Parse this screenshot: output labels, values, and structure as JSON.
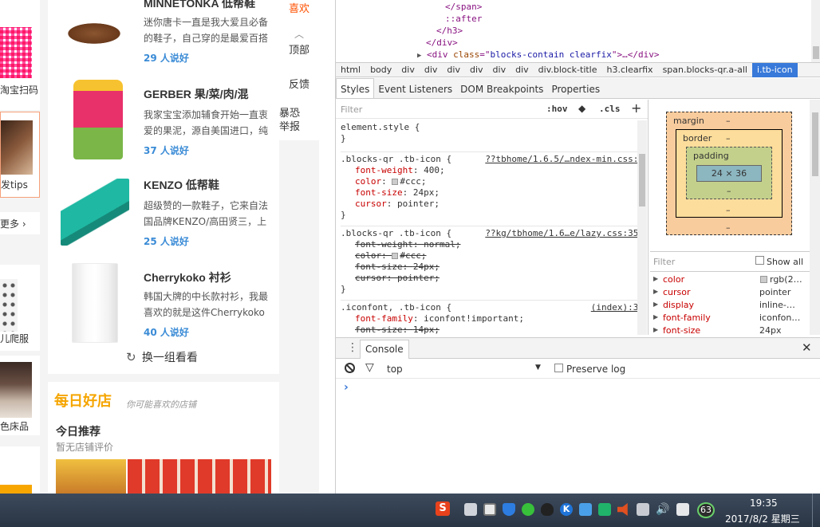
{
  "web": {
    "left_column": {
      "qr_caption": "淘宝扫码",
      "hair_caption": "发tips",
      "more_link": "更多 ›",
      "baby_caption": "儿爬服",
      "bed_caption": "色床品"
    },
    "products": [
      {
        "title": "MINNETONKA 低帮鞋",
        "desc": "迷你唐卡一直是我大爱且必备的鞋子，自己穿的是最爱百搭",
        "likes": "29 人说好"
      },
      {
        "title": "GERBER 果/菜/肉/混",
        "desc": "我家宝宝添加辅食开始一直衷爱的果泥，源自美国进口，纯",
        "likes": "37 人说好"
      },
      {
        "title": "KENZO 低帮鞋",
        "desc": "超级赞的一款鞋子，它来自法国品牌KENZO/高田贤三，上",
        "likes": "25 人说好"
      },
      {
        "title": "Cherrykoko 衬衫",
        "desc": "韩国大牌的中长款衬衫，我最喜欢的就是这件Cherrykoko长",
        "likes": "40 人说好"
      }
    ],
    "refresh_label": "换一组看看",
    "shop_banner": {
      "logo": "每日好店",
      "slogan": "你可能喜欢的店铺"
    },
    "today": {
      "title": "今日推荐",
      "subtitle": "暂无店铺评价"
    },
    "side_nav": {
      "fav": "喜欢",
      "top": "顶部",
      "feedback": "反馈",
      "report": "暴恐举报"
    }
  },
  "devtools": {
    "dom_lines": [
      {
        "indent": 9,
        "text": "</span>",
        "kind": "tag"
      },
      {
        "indent": 9,
        "text": "::after",
        "kind": "pseudo"
      },
      {
        "indent": 8,
        "text": "</h3>",
        "kind": "tag"
      },
      {
        "indent": 7,
        "text": "</div>",
        "kind": "tag"
      }
    ],
    "dom_collapsed": {
      "open": "<div ",
      "attr": "class",
      "eq": "=\"",
      "value": "blocks-contain clearfix",
      "close": "\">…</div>"
    },
    "breadcrumbs": [
      "html",
      "body",
      "div",
      "div",
      "div",
      "div",
      "div",
      "div",
      "div.block-title",
      "h3.clearfix",
      "span.blocks-qr.a-all",
      "i.tb-icon"
    ],
    "tabs": [
      "Styles",
      "Event Listeners",
      "DOM Breakpoints",
      "Properties"
    ],
    "filter_placeholder": "Filter",
    "hov": ":hov",
    "cls": ".cls",
    "plus": "+",
    "rules": [
      {
        "selector": "element.style {",
        "source": "",
        "decls": [],
        "close": "}"
      },
      {
        "selector": ".blocks-qr .tb-icon {",
        "source": "??tbhome/1.6.5/…ndex-min.css:1",
        "decls": [
          {
            "prop": "font-weight",
            "value": "400;",
            "struck": false,
            "swatch": false
          },
          {
            "prop": "color",
            "value": "#ccc;",
            "struck": false,
            "swatch": true
          },
          {
            "prop": "font-size",
            "value": "24px;",
            "struck": false,
            "swatch": false
          },
          {
            "prop": "cursor",
            "value": "pointer;",
            "struck": false,
            "swatch": false
          }
        ],
        "close": "}"
      },
      {
        "selector": ".blocks-qr .tb-icon {",
        "source": "??kg/tbhome/1.6…e/lazy.css:350",
        "decls": [
          {
            "prop": "font-weight",
            "value": "normal;",
            "struck": true,
            "swatch": false
          },
          {
            "prop": "color",
            "value": "#ccc;",
            "struck": true,
            "swatch": true
          },
          {
            "prop": "font-size",
            "value": "24px;",
            "struck": true,
            "swatch": false
          },
          {
            "prop": "cursor",
            "value": "pointer;",
            "struck": true,
            "swatch": false
          }
        ],
        "close": "}"
      },
      {
        "selector": ".iconfont, .tb-icon {",
        "source": "(index):32",
        "decls": [
          {
            "prop": "font-family",
            "value": "iconfont!important;",
            "struck": false,
            "swatch": false
          },
          {
            "prop": "font-size",
            "value": "14px;",
            "struck": true,
            "swatch": false
          }
        ],
        "close": ""
      }
    ],
    "box_model": {
      "margin": "margin",
      "border": "border",
      "padding": "padding",
      "content": "24 × 36",
      "dash": "–"
    },
    "computed_filter": "Filter",
    "show_all": "Show all",
    "computed": [
      {
        "prop": "color",
        "value": "rgb(2…",
        "swatch": true
      },
      {
        "prop": "cursor",
        "value": "pointer",
        "swatch": false
      },
      {
        "prop": "display",
        "value": "inline-…",
        "swatch": false
      },
      {
        "prop": "font-family",
        "value": "iconfon…",
        "swatch": false
      },
      {
        "prop": "font-size",
        "value": "24px",
        "swatch": false
      }
    ],
    "console": {
      "tab": "Console",
      "context": "top",
      "preserve_log": "Preserve log",
      "prompt": "›"
    }
  },
  "taskbar": {
    "time": "19:35",
    "date": "2017/8/2 星期三",
    "badge": "63"
  },
  "colors": {
    "likes": "#3a8bd6",
    "accent_orange": "#ff5000",
    "devtools_selected": "#3879d9"
  }
}
